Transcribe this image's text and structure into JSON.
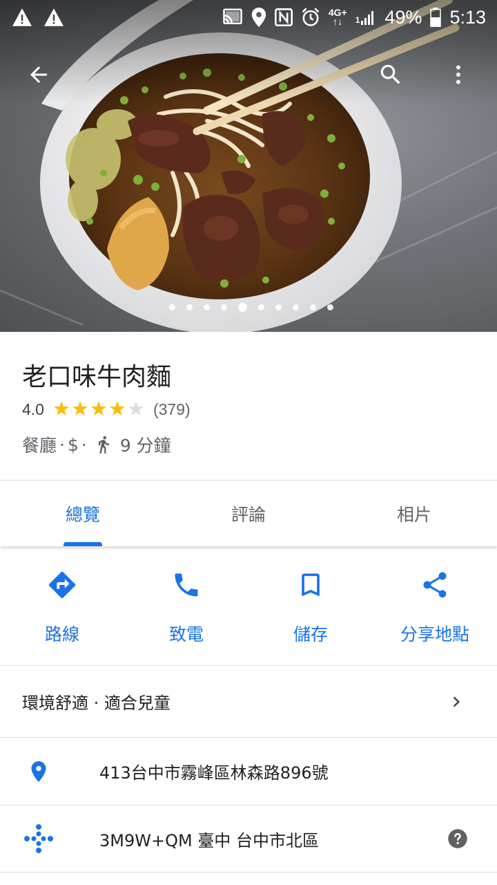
{
  "status_bar": {
    "network_top": "4G+",
    "network_bottom": "↑↓",
    "signal_label": "1",
    "battery": "49%",
    "time": "5:13"
  },
  "icons": {
    "back": "arrow-back-icon",
    "search": "search-icon",
    "more": "more-vert-icon",
    "directions": "directions-icon",
    "call": "phone-icon",
    "save": "bookmark-icon",
    "share": "share-icon",
    "location": "place-pin-icon",
    "plus_code": "plus-code-icon",
    "help": "help-icon"
  },
  "carousel": {
    "dot_count": 10,
    "active_index": 4
  },
  "place": {
    "name": "老口味牛肉麵",
    "rating": "4.0",
    "rating_value": 4,
    "rating_max": 5,
    "review_count": "(379)",
    "category": "餐廳",
    "price": "$",
    "walk_time": "9 分鐘",
    "separator": "·"
  },
  "tabs": [
    {
      "label": "總覽",
      "active": true
    },
    {
      "label": "評論",
      "active": false
    },
    {
      "label": "相片",
      "active": false
    }
  ],
  "actions": [
    {
      "label": "路線"
    },
    {
      "label": "致電"
    },
    {
      "label": "儲存"
    },
    {
      "label": "分享地點"
    }
  ],
  "rows": {
    "highlights": "環境舒適 · 適合兒童",
    "address": "413台中市霧峰區林森路896號",
    "plus_code": "3M9W+QM 臺中 台中市北區"
  },
  "colors": {
    "accent": "#1a73e8",
    "star": "#fbbc04",
    "star_empty": "#dadce0",
    "text_primary": "#212121",
    "text_secondary": "#5f6368",
    "divider": "#e0e0e0"
  }
}
